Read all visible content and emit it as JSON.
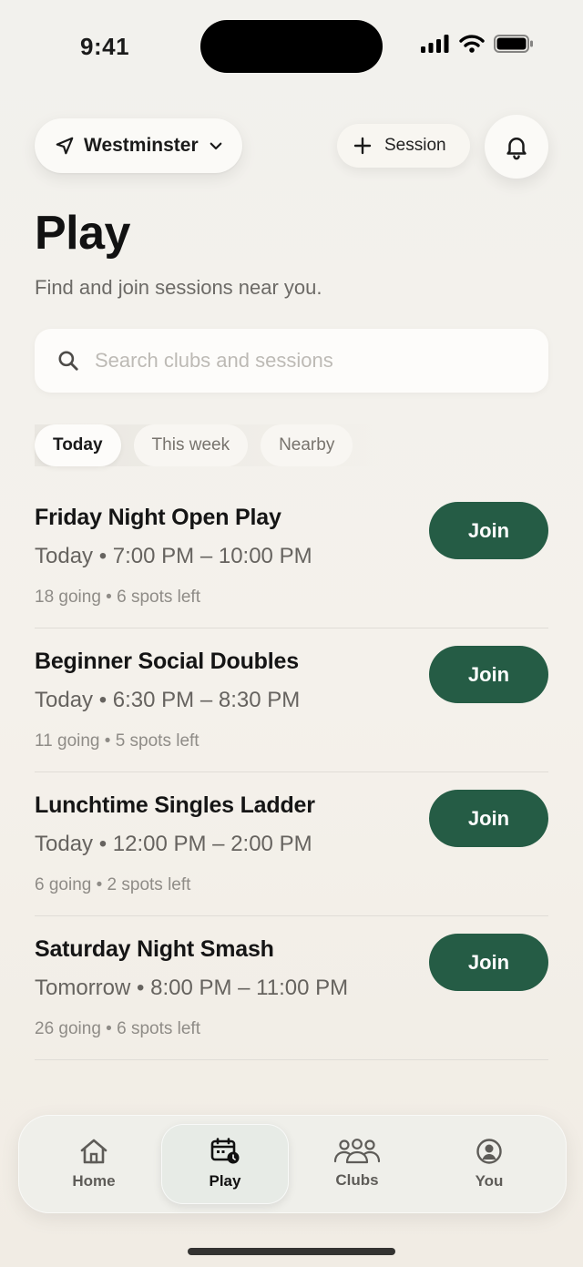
{
  "status_bar": {
    "time": "9:41"
  },
  "header": {
    "location": "Westminster",
    "session_button": "Session"
  },
  "page": {
    "title": "Play",
    "subtitle": "Find and join sessions near you."
  },
  "search": {
    "placeholder": "Search clubs and sessions",
    "value": ""
  },
  "filters": [
    {
      "label": "Today",
      "active": true
    },
    {
      "label": "This week",
      "active": false
    },
    {
      "label": "Nearby",
      "active": false
    }
  ],
  "sessions": [
    {
      "title": "Friday Night Open Play",
      "when": "Today • 7:00 PM – 10:00 PM",
      "meta": "18 going • 6 spots left",
      "action": "Join"
    },
    {
      "title": "Beginner Social Doubles",
      "when": "Today • 6:30 PM – 8:30 PM",
      "meta": "11 going • 5 spots left",
      "action": "Join"
    },
    {
      "title": "Lunchtime Singles Ladder",
      "when": "Today • 12:00 PM – 2:00 PM",
      "meta": "6 going • 2 spots left",
      "action": "Join"
    },
    {
      "title": "Saturday Night Smash",
      "when": "Tomorrow • 8:00 PM – 11:00 PM",
      "meta": "26 going • 6 spots left",
      "action": "Join"
    }
  ],
  "tabbar": [
    {
      "label": "Home",
      "icon": "home-icon",
      "active": false
    },
    {
      "label": "Play",
      "icon": "calendar-icon",
      "active": true
    },
    {
      "label": "Clubs",
      "icon": "people-icon",
      "active": false
    },
    {
      "label": "You",
      "icon": "profile-icon",
      "active": false
    }
  ],
  "colors": {
    "accent": "#255c45",
    "background": "#f3f0ea",
    "text_primary": "#151515",
    "text_secondary": "#66635f"
  }
}
